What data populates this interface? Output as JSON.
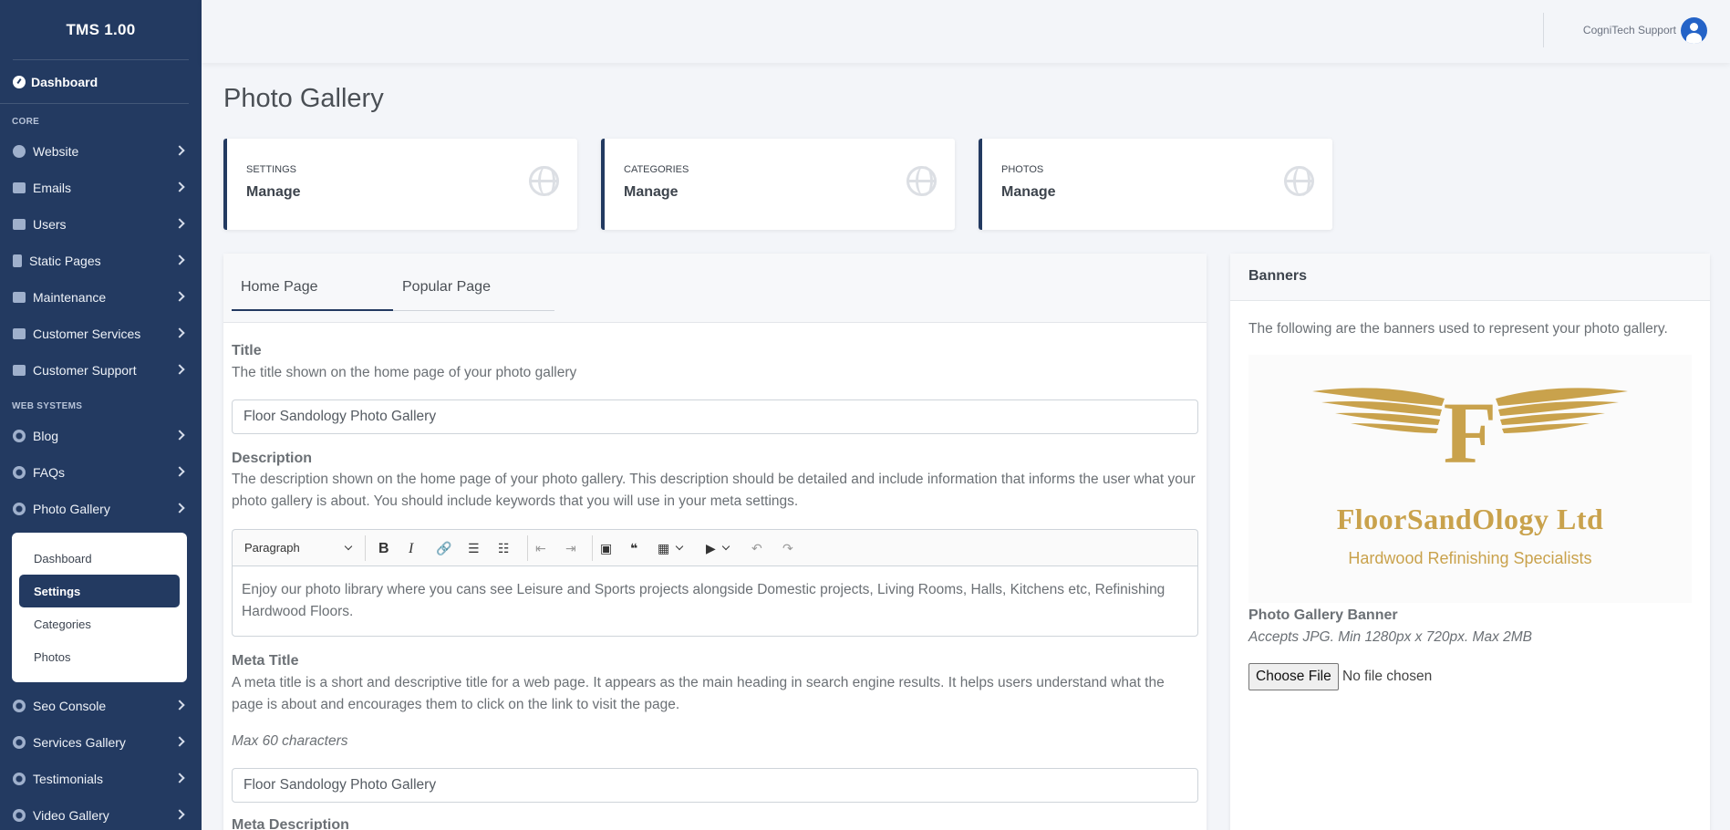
{
  "brand": "TMS 1.00",
  "sidebar": {
    "dashboard": "Dashboard",
    "core_heading": "CORE",
    "core_items": [
      "Website",
      "Emails",
      "Users",
      "Static Pages",
      "Maintenance",
      "Customer Services",
      "Customer Support"
    ],
    "web_heading": "WEB SYSTEMS",
    "web_items": [
      "Blog",
      "FAQs",
      "Photo Gallery"
    ],
    "submenu": [
      "Dashboard",
      "Settings",
      "Categories",
      "Photos"
    ],
    "submenu_active": "Settings",
    "after_items": [
      "Seo Console",
      "Services Gallery",
      "Testimonials",
      "Video Gallery"
    ]
  },
  "topbar": {
    "user": "CogniTech Support"
  },
  "page_title": "Photo Gallery",
  "cards": [
    {
      "label": "SETTINGS",
      "value": "Manage"
    },
    {
      "label": "CATEGORIES",
      "value": "Manage"
    },
    {
      "label": "PHOTOS",
      "value": "Manage"
    }
  ],
  "tabs": [
    "Home Page",
    "Popular Page"
  ],
  "form": {
    "title_label": "Title",
    "title_help": "The title shown on the home page of your photo gallery",
    "title_value": "Floor Sandology Photo Gallery",
    "desc_label": "Description",
    "desc_help": "The description shown on the home page of your photo gallery. This description should be detailed and include information that informs the user what your photo gallery is about. You should include keywords that you will use in your meta settings.",
    "editor_style": "Paragraph",
    "editor_text": "Enjoy our photo library where you cans see Leisure and Sports projects alongside Domestic projects, Living Rooms, Halls, Kitchens etc, Refinishing Hardwood Floors.",
    "meta_title_label": "Meta Title",
    "meta_title_help": "A meta title is a short and descriptive title for a web page. It appears as the main heading in search engine results. It helps users understand what the page is about and encourages them to click on the link to visit the page.",
    "meta_title_max": "Max 60 characters",
    "meta_title_value": "Floor Sandology Photo Gallery",
    "meta_desc_label": "Meta Description"
  },
  "banners": {
    "heading": "Banners",
    "intro": "The following are the banners used to represent your photo gallery.",
    "logo_name": "FloorSandOlogy Ltd",
    "logo_sub": "Hardwood Refinishing Specialists",
    "logo_letter": "F",
    "field_label": "Photo Gallery Banner",
    "field_help": "Accepts JPG. Min 1280px x 720px. Max 2MB",
    "choose_file": "Choose File",
    "no_file": "No file chosen"
  },
  "colors": {
    "sidebar": "#233a61",
    "accent_gold": "#c9a24c",
    "avatar": "#2463c7"
  }
}
